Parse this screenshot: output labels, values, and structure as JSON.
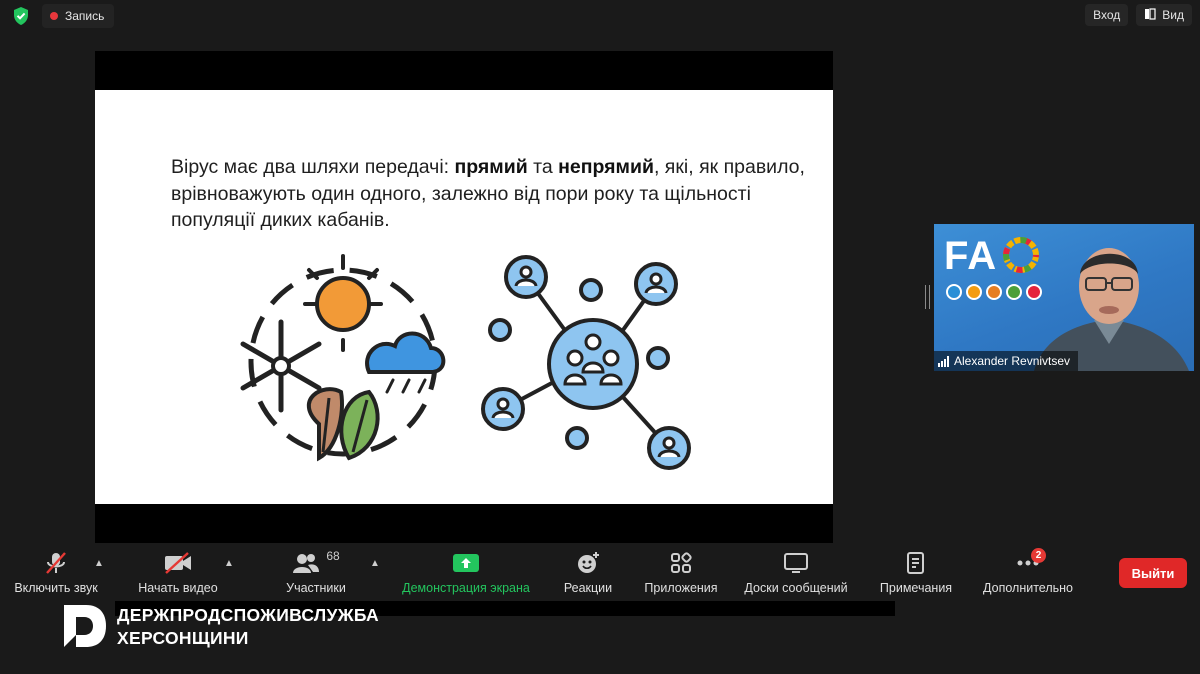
{
  "top_bar": {
    "shield_icon": "green-shield-check",
    "recording_label": "Запись",
    "login_label": "Вход",
    "view_label": "Вид"
  },
  "slide": {
    "text_part1": "Вірус має два шляхи передачі: ",
    "bold1": "прямий",
    "text_part2": " та ",
    "bold2": "непрямий",
    "text_part3": ", які, як правило, врівноважують один одного, залежно від пори року та щільності популяції диких кабанів.",
    "illustration_left": "seasons-icon",
    "illustration_right": "network-people-icon"
  },
  "video": {
    "logo_text": "FA",
    "participant_name": "Alexander Revnivtsev"
  },
  "toolbar": {
    "mute_label": "Включить звук",
    "video_label": "Начать видео",
    "participants_label": "Участники",
    "participants_count": "68",
    "share_label": "Демонстрация экрана",
    "reactions_label": "Реакции",
    "apps_label": "Приложения",
    "whiteboards_label": "Доски сообщений",
    "notes_label": "Примечания",
    "more_label": "Дополнительно",
    "more_badge": "2",
    "leave_label": "Выйти"
  },
  "branding": {
    "line1": "ДЕРЖПРОДСПОЖИВСЛУЖБА",
    "line2": "ХЕРСОНЩИНИ"
  },
  "colors": {
    "share_green": "#23c55e",
    "leave_red": "#e02828",
    "icon_blue": "#8ec5f0",
    "sun_orange": "#f29a37"
  }
}
